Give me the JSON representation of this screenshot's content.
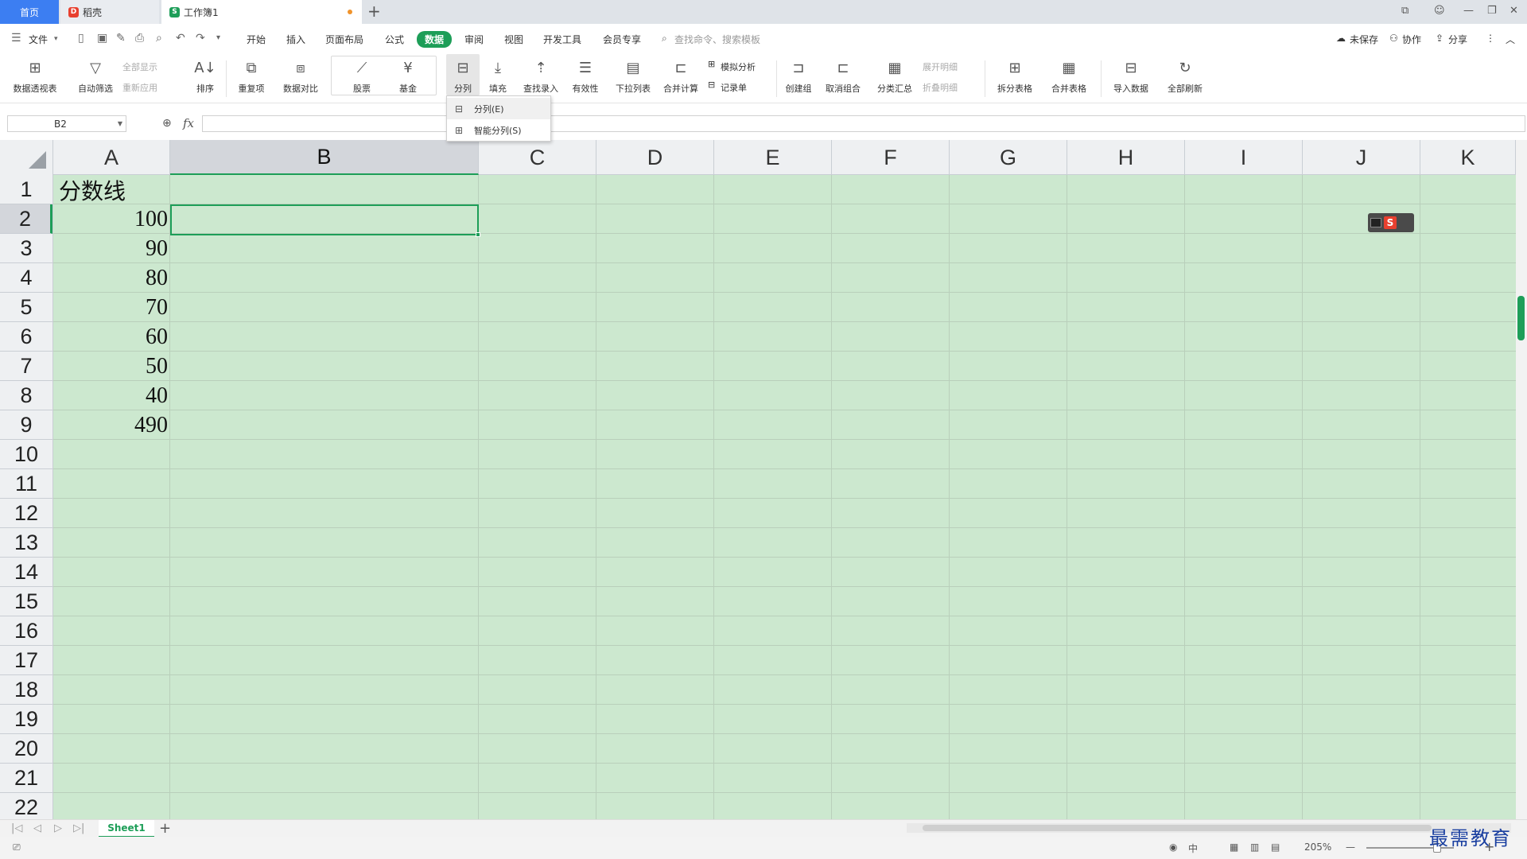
{
  "titlebar": {
    "tabs": [
      {
        "label": "首页"
      },
      {
        "label": "稻壳"
      },
      {
        "label": "工作簿1"
      }
    ],
    "colors": {
      "home_tab": "#3c7ef2",
      "accent": "#1d9e58"
    }
  },
  "menubar": {
    "file": "文件",
    "items": [
      "开始",
      "插入",
      "页面布局",
      "公式",
      "数据",
      "审阅",
      "视图",
      "开发工具",
      "会员专享"
    ],
    "active": "数据",
    "search_placeholder": "查找命令、搜索模板",
    "right": [
      "未保存",
      "协作",
      "分享"
    ]
  },
  "ribbon": {
    "pivot": "数据透视表",
    "autofilter": "自动筛选",
    "show_all": "全部显示",
    "reapply": "重新应用",
    "sort": "排序",
    "duplicates": "重复项",
    "compare": "数据对比",
    "stock": "股票",
    "fund": "基金",
    "split": "分列",
    "fill": "填充",
    "lookup": "查找录入",
    "validity": "有效性",
    "dropdown_list": "下拉列表",
    "consolidate": "合并计算",
    "whatif": "模拟分析",
    "record": "记录单",
    "group": "创建组",
    "ungroup": "取消组合",
    "subtotal": "分类汇总",
    "expand": "展开明细",
    "collapse": "折叠明细",
    "split_table": "拆分表格",
    "merge_table": "合并表格",
    "import": "导入数据",
    "refresh_all": "全部刷新"
  },
  "dropdown": {
    "items": [
      {
        "label": "分列(E)"
      },
      {
        "label": "智能分列(S)"
      }
    ]
  },
  "formula_bar": {
    "name_box": "B2",
    "fx": "fx",
    "content": ""
  },
  "sheet": {
    "columns": [
      "A",
      "B",
      "C",
      "D",
      "E",
      "F",
      "G",
      "H",
      "I",
      "J",
      "K"
    ],
    "selected_column": "B",
    "selected_row": 2,
    "rows": [
      "1",
      "2",
      "3",
      "4",
      "5",
      "6",
      "7",
      "8",
      "9",
      "10",
      "11",
      "12",
      "13",
      "14",
      "15",
      "16",
      "17",
      "18",
      "19",
      "20",
      "21",
      "22"
    ],
    "cells": {
      "A1": "分数线",
      "A2": "100",
      "A3": "90",
      "A4": "80",
      "A5": "70",
      "A6": "60",
      "A7": "50",
      "A8": "40",
      "A9": "490"
    },
    "grid_color": "#cce8cf"
  },
  "sheet_tabs": {
    "active": "Sheet1",
    "add": "+"
  },
  "statusbar": {
    "zoom": "205%"
  },
  "watermark": "最需教育"
}
